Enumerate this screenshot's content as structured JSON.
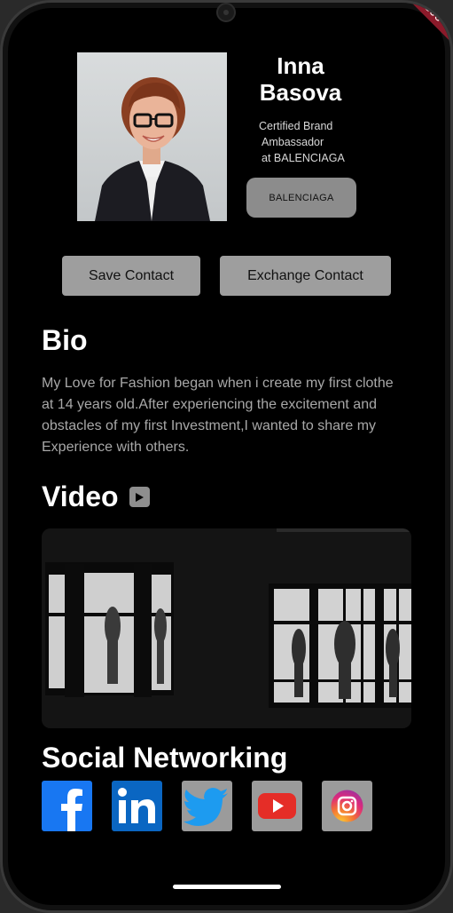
{
  "profile": {
    "name": "Inna Basova",
    "title_line1": "Certified Brand",
    "title_line2": "Ambassador",
    "title_line3": "at BALENCIAGA",
    "brand_button": "BALENCIAGA"
  },
  "actions": {
    "save_label": "Save Contact",
    "exchange_label": "Exchange Contact"
  },
  "bio": {
    "heading": "Bio",
    "text": "My Love for Fashion began when i create my first clothe at 14 years old.After experiencing the excitement and obstacles of my first Investment,I wanted to share my Experience with others."
  },
  "video": {
    "heading": "Video",
    "icon": "play-icon"
  },
  "social": {
    "heading": "Social Networking",
    "icons": [
      "facebook-icon",
      "linkedin-icon",
      "twitter-icon",
      "youtube-icon",
      "instagram-icon"
    ]
  },
  "debug_banner": "DEBUG",
  "colors": {
    "background": "#000000",
    "button_gray": "#9e9e9e",
    "brand_button": "#8c8c8c",
    "facebook": "#1877f2",
    "linkedin": "#0a66c2",
    "youtube_red": "#e52d27"
  }
}
